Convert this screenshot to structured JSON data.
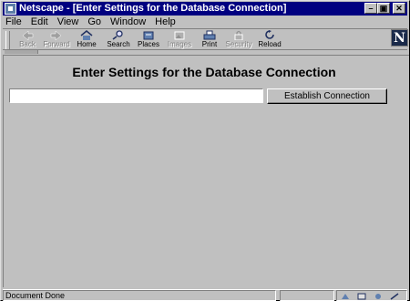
{
  "window": {
    "title": "Netscape - [Enter Settings for the Database Connection]",
    "minimize_glyph": "–",
    "restore_glyph": "▣",
    "close_glyph": "✕"
  },
  "menu": {
    "items": [
      {
        "label": "File"
      },
      {
        "label": "Edit"
      },
      {
        "label": "View"
      },
      {
        "label": "Go"
      },
      {
        "label": "Window"
      },
      {
        "label": "Help"
      }
    ]
  },
  "toolbar": {
    "buttons": [
      {
        "label": "Back",
        "icon": "back-arrow-icon",
        "enabled": false
      },
      {
        "label": "Forward",
        "icon": "forward-arrow-icon",
        "enabled": false
      },
      {
        "label": "Home",
        "icon": "home-icon",
        "enabled": true
      },
      {
        "label": "Search",
        "icon": "search-icon",
        "enabled": true
      },
      {
        "label": "Places",
        "icon": "places-icon",
        "enabled": true
      },
      {
        "label": "Images",
        "icon": "images-icon",
        "enabled": false
      },
      {
        "label": "Print",
        "icon": "printer-icon",
        "enabled": true
      },
      {
        "label": "Security",
        "icon": "lock-icon",
        "enabled": false
      },
      {
        "label": "Reload",
        "icon": "reload-icon",
        "enabled": true
      }
    ],
    "logo_letter": "N"
  },
  "page": {
    "heading": "Enter Settings for the Database Connection",
    "settings_value": "",
    "connect_label": "Establish Connection"
  },
  "status": {
    "text": "Document Done"
  },
  "colors": {
    "titlebar": "#000080",
    "chrome": "#c0c0c0"
  }
}
